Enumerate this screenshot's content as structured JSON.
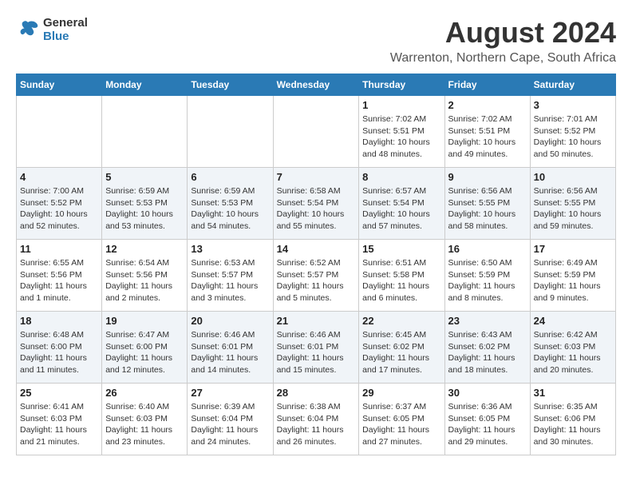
{
  "header": {
    "logo_line1": "General",
    "logo_line2": "Blue",
    "month_year": "August 2024",
    "location": "Warrenton, Northern Cape, South Africa"
  },
  "weekdays": [
    "Sunday",
    "Monday",
    "Tuesday",
    "Wednesday",
    "Thursday",
    "Friday",
    "Saturday"
  ],
  "weeks": [
    [
      {
        "day": "",
        "info": ""
      },
      {
        "day": "",
        "info": ""
      },
      {
        "day": "",
        "info": ""
      },
      {
        "day": "",
        "info": ""
      },
      {
        "day": "1",
        "info": "Sunrise: 7:02 AM\nSunset: 5:51 PM\nDaylight: 10 hours and 48 minutes."
      },
      {
        "day": "2",
        "info": "Sunrise: 7:02 AM\nSunset: 5:51 PM\nDaylight: 10 hours and 49 minutes."
      },
      {
        "day": "3",
        "info": "Sunrise: 7:01 AM\nSunset: 5:52 PM\nDaylight: 10 hours and 50 minutes."
      }
    ],
    [
      {
        "day": "4",
        "info": "Sunrise: 7:00 AM\nSunset: 5:52 PM\nDaylight: 10 hours and 52 minutes."
      },
      {
        "day": "5",
        "info": "Sunrise: 6:59 AM\nSunset: 5:53 PM\nDaylight: 10 hours and 53 minutes."
      },
      {
        "day": "6",
        "info": "Sunrise: 6:59 AM\nSunset: 5:53 PM\nDaylight: 10 hours and 54 minutes."
      },
      {
        "day": "7",
        "info": "Sunrise: 6:58 AM\nSunset: 5:54 PM\nDaylight: 10 hours and 55 minutes."
      },
      {
        "day": "8",
        "info": "Sunrise: 6:57 AM\nSunset: 5:54 PM\nDaylight: 10 hours and 57 minutes."
      },
      {
        "day": "9",
        "info": "Sunrise: 6:56 AM\nSunset: 5:55 PM\nDaylight: 10 hours and 58 minutes."
      },
      {
        "day": "10",
        "info": "Sunrise: 6:56 AM\nSunset: 5:55 PM\nDaylight: 10 hours and 59 minutes."
      }
    ],
    [
      {
        "day": "11",
        "info": "Sunrise: 6:55 AM\nSunset: 5:56 PM\nDaylight: 11 hours and 1 minute."
      },
      {
        "day": "12",
        "info": "Sunrise: 6:54 AM\nSunset: 5:56 PM\nDaylight: 11 hours and 2 minutes."
      },
      {
        "day": "13",
        "info": "Sunrise: 6:53 AM\nSunset: 5:57 PM\nDaylight: 11 hours and 3 minutes."
      },
      {
        "day": "14",
        "info": "Sunrise: 6:52 AM\nSunset: 5:57 PM\nDaylight: 11 hours and 5 minutes."
      },
      {
        "day": "15",
        "info": "Sunrise: 6:51 AM\nSunset: 5:58 PM\nDaylight: 11 hours and 6 minutes."
      },
      {
        "day": "16",
        "info": "Sunrise: 6:50 AM\nSunset: 5:59 PM\nDaylight: 11 hours and 8 minutes."
      },
      {
        "day": "17",
        "info": "Sunrise: 6:49 AM\nSunset: 5:59 PM\nDaylight: 11 hours and 9 minutes."
      }
    ],
    [
      {
        "day": "18",
        "info": "Sunrise: 6:48 AM\nSunset: 6:00 PM\nDaylight: 11 hours and 11 minutes."
      },
      {
        "day": "19",
        "info": "Sunrise: 6:47 AM\nSunset: 6:00 PM\nDaylight: 11 hours and 12 minutes."
      },
      {
        "day": "20",
        "info": "Sunrise: 6:46 AM\nSunset: 6:01 PM\nDaylight: 11 hours and 14 minutes."
      },
      {
        "day": "21",
        "info": "Sunrise: 6:46 AM\nSunset: 6:01 PM\nDaylight: 11 hours and 15 minutes."
      },
      {
        "day": "22",
        "info": "Sunrise: 6:45 AM\nSunset: 6:02 PM\nDaylight: 11 hours and 17 minutes."
      },
      {
        "day": "23",
        "info": "Sunrise: 6:43 AM\nSunset: 6:02 PM\nDaylight: 11 hours and 18 minutes."
      },
      {
        "day": "24",
        "info": "Sunrise: 6:42 AM\nSunset: 6:03 PM\nDaylight: 11 hours and 20 minutes."
      }
    ],
    [
      {
        "day": "25",
        "info": "Sunrise: 6:41 AM\nSunset: 6:03 PM\nDaylight: 11 hours and 21 minutes."
      },
      {
        "day": "26",
        "info": "Sunrise: 6:40 AM\nSunset: 6:03 PM\nDaylight: 11 hours and 23 minutes."
      },
      {
        "day": "27",
        "info": "Sunrise: 6:39 AM\nSunset: 6:04 PM\nDaylight: 11 hours and 24 minutes."
      },
      {
        "day": "28",
        "info": "Sunrise: 6:38 AM\nSunset: 6:04 PM\nDaylight: 11 hours and 26 minutes."
      },
      {
        "day": "29",
        "info": "Sunrise: 6:37 AM\nSunset: 6:05 PM\nDaylight: 11 hours and 27 minutes."
      },
      {
        "day": "30",
        "info": "Sunrise: 6:36 AM\nSunset: 6:05 PM\nDaylight: 11 hours and 29 minutes."
      },
      {
        "day": "31",
        "info": "Sunrise: 6:35 AM\nSunset: 6:06 PM\nDaylight: 11 hours and 30 minutes."
      }
    ]
  ]
}
